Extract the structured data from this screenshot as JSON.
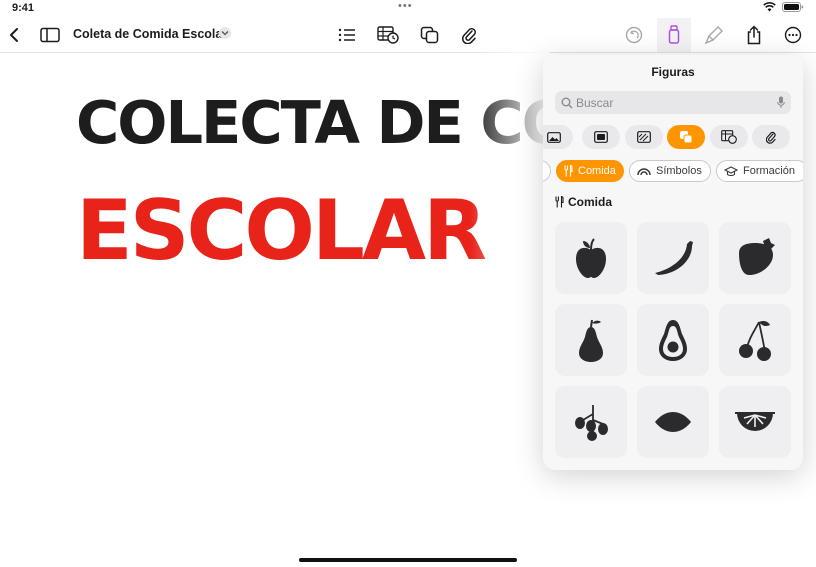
{
  "status_bar": {
    "time": "9:41"
  },
  "toolbar": {
    "doc_title": "Coleta de Comida Escolar"
  },
  "document": {
    "line1": "COLECTA DE COMIDA",
    "line2": "ESCOLAR"
  },
  "shapes_panel": {
    "title": "Figuras",
    "search_placeholder": "Buscar",
    "categories": [
      {
        "label": "Comida",
        "icon": "fork-knife-icon"
      },
      {
        "label": "Símbolos",
        "icon": "rainbow-icon"
      },
      {
        "label": "Formación",
        "icon": "graduation-cap-icon"
      }
    ],
    "section_title": "Comida",
    "shapes": [
      "apple",
      "banana",
      "strawberry",
      "pear",
      "avocado",
      "cherries",
      "olives",
      "lemon",
      "orange-slice"
    ]
  },
  "colors": {
    "accent": "#ff9500",
    "title_red": "#e8231a",
    "active_purple": "#af52de"
  }
}
